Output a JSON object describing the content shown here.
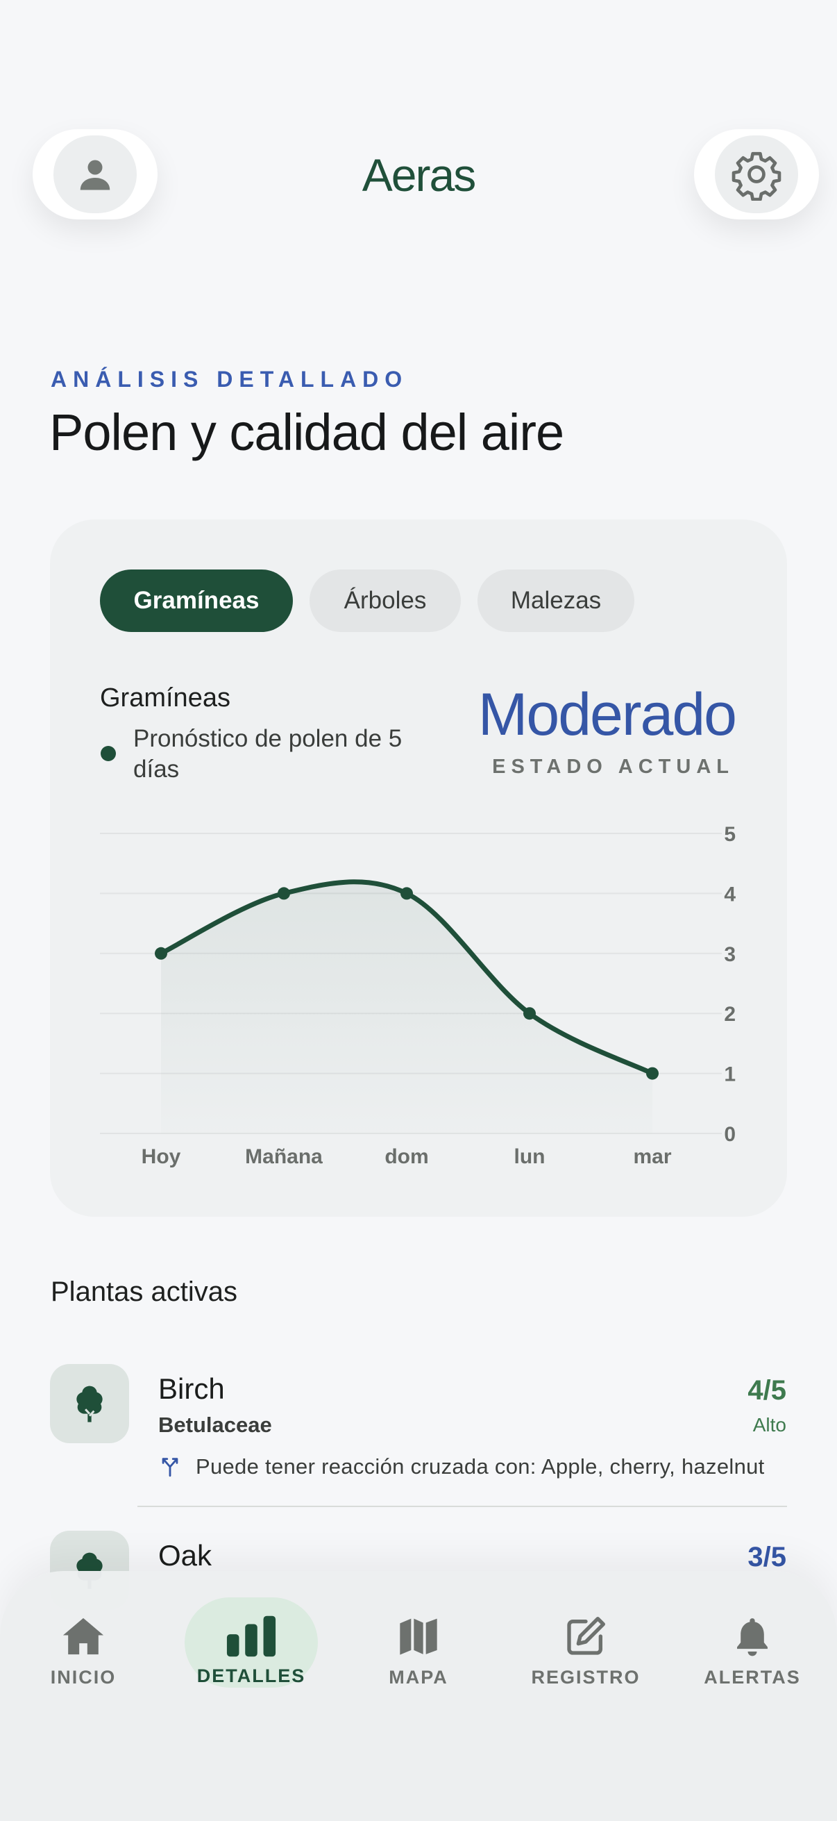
{
  "header": {
    "title": "Aeras",
    "profile_icon": "person-icon",
    "settings_icon": "gear-icon"
  },
  "eyebrow": "ANÁLISIS DETALLADO",
  "page_title": "Polen y calidad del aire",
  "tabs": [
    {
      "label": "Gramíneas",
      "active": true
    },
    {
      "label": "Árboles",
      "active": false
    },
    {
      "label": "Malezas",
      "active": false
    }
  ],
  "forecast": {
    "title": "Gramíneas",
    "legend": "Pronóstico de polen de 5 días",
    "status_value": "Moderado",
    "status_label": "ESTADO ACTUAL"
  },
  "chart_data": {
    "type": "area",
    "categories": [
      "Hoy",
      "Mañana",
      "dom",
      "lun",
      "mar"
    ],
    "series": [
      {
        "name": "Pronóstico de polen de 5 días",
        "values": [
          3,
          4,
          4,
          2,
          1
        ]
      }
    ],
    "yticks": [
      0,
      1,
      2,
      3,
      4,
      5
    ],
    "ylim": [
      0,
      5
    ],
    "grid": true,
    "y_axis_side": "right",
    "color": "#1f4f39"
  },
  "plants_section": {
    "title": "Plantas activas",
    "items": [
      {
        "name": "Birch",
        "family": "Betulaceae",
        "score": "4/5",
        "level": "Alto",
        "score_color": "#3e7a4e",
        "icon": "tree-icon",
        "cross_reaction": "Puede tener reacción cruzada con: Apple, cherry, hazelnut"
      },
      {
        "name": "Oak",
        "score": "3/5",
        "score_color": "#3556a6",
        "icon": "tree-icon"
      }
    ]
  },
  "nav": [
    {
      "label": "INICIO",
      "icon": "home-icon",
      "active": false
    },
    {
      "label": "DETALLES",
      "icon": "bar-chart-icon",
      "active": true
    },
    {
      "label": "MAPA",
      "icon": "map-icon",
      "active": false
    },
    {
      "label": "REGISTRO",
      "icon": "edit-icon",
      "active": false
    },
    {
      "label": "ALERTAS",
      "icon": "bell-icon",
      "active": false
    }
  ]
}
